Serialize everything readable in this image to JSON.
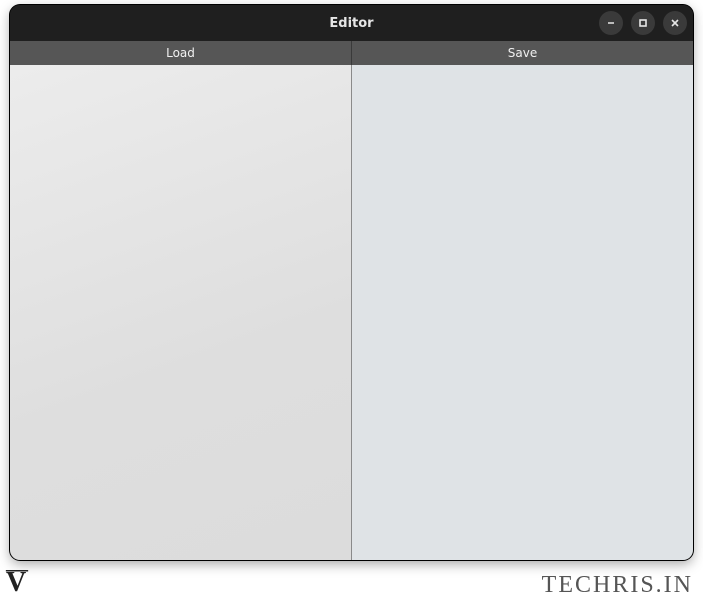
{
  "window": {
    "title": "Editor",
    "controls": {
      "minimize_tooltip": "Minimize",
      "maximize_tooltip": "Maximize",
      "close_tooltip": "Close"
    }
  },
  "toolbar": {
    "load_label": "Load",
    "save_label": "Save"
  },
  "panes": {
    "left_content": "",
    "right_content": ""
  },
  "watermark": {
    "left": "V",
    "right": "TECHRIS.IN"
  }
}
